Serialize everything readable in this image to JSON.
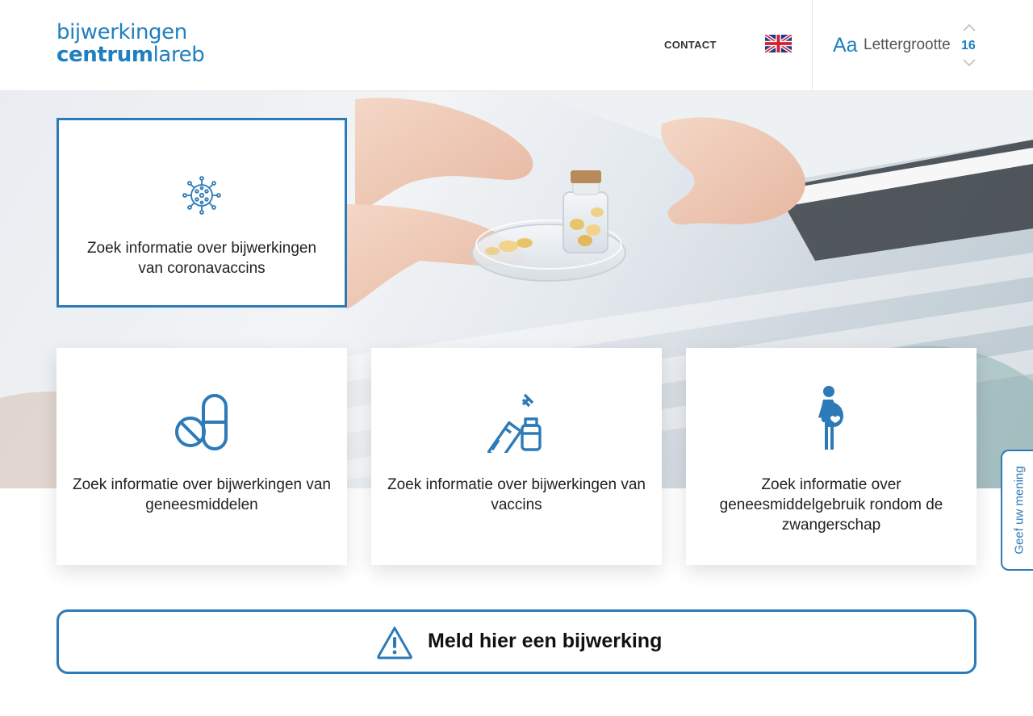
{
  "header": {
    "logo_line1": "bijwerkingen",
    "logo_line2_bold": "centrum",
    "logo_line2_light": "lareb",
    "contact_label": "CONTACT",
    "font_icon_label": "Aa",
    "font_label": "Lettergrootte",
    "font_size_value": "16"
  },
  "cards": {
    "corona": {
      "text": "Zoek informatie over bijwerkingen van coronavaccins",
      "icon": "virus-icon"
    },
    "medicines": {
      "text": "Zoek informatie over bijwerkingen van geneesmiddelen",
      "icon": "pills-icon"
    },
    "vaccines": {
      "text": "Zoek informatie over bijwerkingen van vaccins",
      "icon": "syringe-vial-icon"
    },
    "pregnancy": {
      "text": "Zoek informatie over geneesmiddelgebruik rondom de zwangerschap",
      "icon": "pregnant-woman-icon"
    }
  },
  "report": {
    "label": "Meld hier een bijwerking",
    "icon": "warning-icon"
  },
  "feedback": {
    "label": "Geef uw mening"
  },
  "colors": {
    "brand_blue": "#1f7fbf",
    "border_blue": "#2d7ab8"
  }
}
